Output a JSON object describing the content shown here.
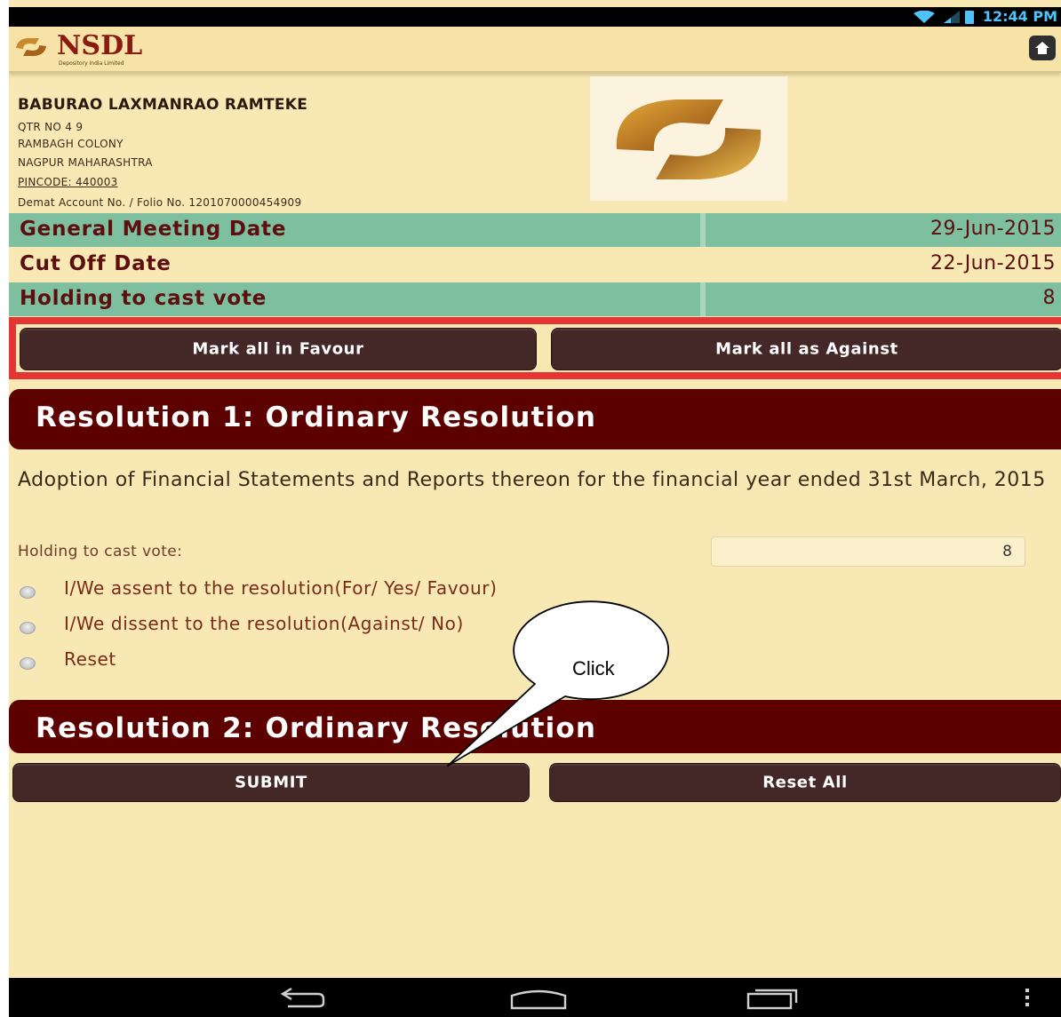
{
  "status_bar": {
    "time": "12:44 PM"
  },
  "header": {
    "logo_text": "NSDL",
    "logo_tagline": "Depository India Limited"
  },
  "account": {
    "name": "BABURAO LAXMANRAO RAMTEKE",
    "address_lines": [
      "QTR NO 4 9",
      "RAMBAGH COLONY",
      "NAGPUR MAHARASHTRA"
    ],
    "pincode": "PINCODE: 440003",
    "demat": "Demat Account No. / Folio No. 1201070000454909"
  },
  "info": [
    {
      "label": "General Meeting Date",
      "value": "29-Jun-2015"
    },
    {
      "label": "Cut Off Date",
      "value": "22-Jun-2015"
    },
    {
      "label": "Holding to cast vote",
      "value": "8"
    }
  ],
  "mark_all": {
    "favour_label": "Mark all in Favour",
    "against_label": "Mark all as Against"
  },
  "resolutions": [
    {
      "title": "Resolution 1: Ordinary Resolution",
      "description": "Adoption of Financial Statements and Reports thereon for the financial year ended 31st March, 2015",
      "holding_label": "Holding to cast vote:",
      "holding_value": "8",
      "options": [
        "I/We assent to the resolution(For/ Yes/ Favour)",
        "I/We dissent to the resolution(Against/ No)",
        "Reset"
      ]
    },
    {
      "title": "Resolution 2: Ordinary Resolution"
    }
  ],
  "actions": {
    "submit_label": "SUBMIT",
    "reset_all_label": "Reset All"
  },
  "callout": {
    "text": "Click"
  },
  "colors": {
    "background": "#f8e8b4",
    "teal_row": "#7dbf9e",
    "maroon": "#5c0000",
    "button": "#442828",
    "highlight_red": "#e53434"
  },
  "icons": [
    "wifi-icon",
    "signal-icon",
    "battery-icon",
    "home-icon",
    "back-icon",
    "home-nav-icon",
    "recent-apps-icon",
    "overflow-menu-icon"
  ]
}
